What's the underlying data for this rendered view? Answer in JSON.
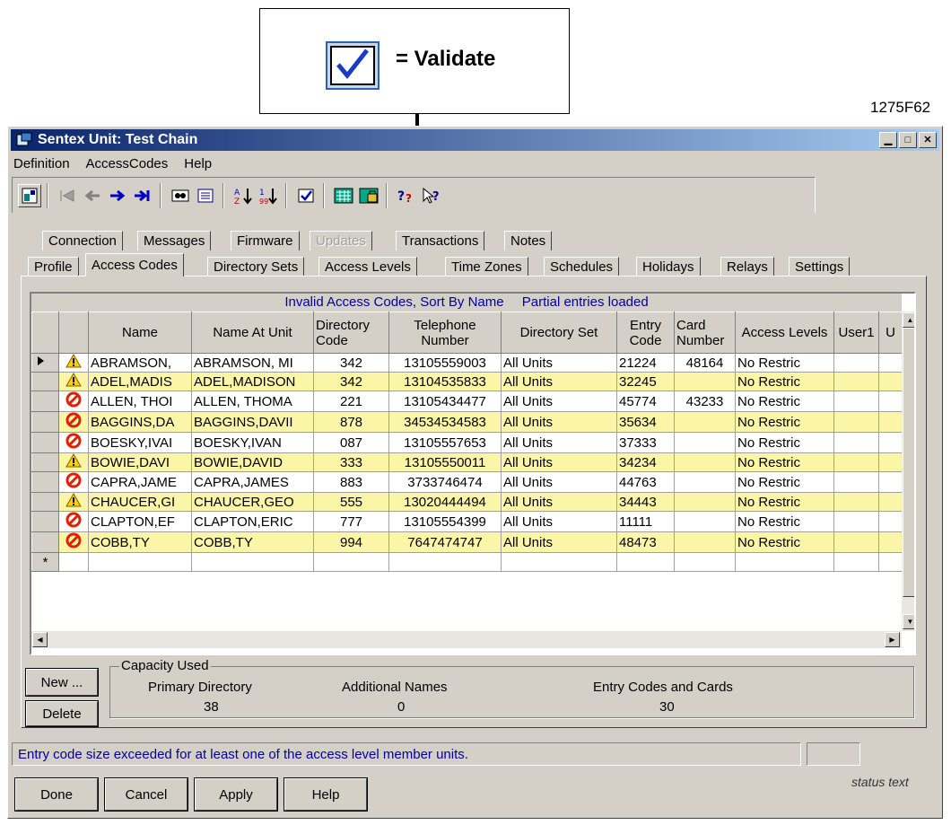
{
  "callout": {
    "label": "= Validate",
    "figure_id": "1275F62"
  },
  "window": {
    "title": "Sentex Unit: Test Chain",
    "controls": [
      "_",
      "□",
      "×"
    ]
  },
  "menu": {
    "definition": "Definition",
    "access_codes": "AccessCodes",
    "help": "Help"
  },
  "tabs_row1": [
    "Connection",
    "Messages",
    "Firmware",
    "Updates",
    "Transactions",
    "Notes"
  ],
  "tabs_row2": [
    "Profile",
    "Access Codes",
    "Directory Sets",
    "Access Levels",
    "Time Zones",
    "Schedules",
    "Holidays",
    "Relays",
    "Settings"
  ],
  "grid": {
    "caption_left": "Invalid Access Codes, Sort By Name",
    "caption_right": "Partial entries loaded",
    "headers": {
      "name": "Name",
      "name_at_unit": "Name At Unit",
      "directory_code": "Directory Code",
      "telephone": "Telephone Number",
      "directory_set": "Directory Set",
      "entry_code": "Entry Code",
      "card_number": "Card Number",
      "access_levels": "Access Levels",
      "user1": "User1",
      "user2": "U"
    },
    "rows": [
      {
        "status": "warning",
        "name": "ABRAMSON,",
        "name_at_unit": "ABRAMSON, MI",
        "directory_code": "342",
        "telephone": "13105559003",
        "directory_set": "All Units",
        "entry_code": "21224",
        "card_number": "48164",
        "access_levels": "No Restric",
        "current": true
      },
      {
        "status": "warning",
        "name": "ADEL,MADIS",
        "name_at_unit": "ADEL,MADISON",
        "directory_code": "342",
        "telephone": "13104535833",
        "directory_set": "All Units",
        "entry_code": "32245",
        "card_number": "",
        "access_levels": "No Restric"
      },
      {
        "status": "error",
        "name": "ALLEN, THOI",
        "name_at_unit": "ALLEN, THOMA",
        "directory_code": "221",
        "telephone": "13105434477",
        "directory_set": "All Units",
        "entry_code": "45774",
        "card_number": "43233",
        "access_levels": "No Restric"
      },
      {
        "status": "error",
        "name": "BAGGINS,DA",
        "name_at_unit": "BAGGINS,DAVII",
        "directory_code": "878",
        "telephone": "34534534583",
        "directory_set": "All Units",
        "entry_code": "35634",
        "card_number": "",
        "access_levels": "No Restric"
      },
      {
        "status": "error",
        "name": "BOESKY,IVAI",
        "name_at_unit": "BOESKY,IVAN",
        "directory_code": "087",
        "telephone": "13105557653",
        "directory_set": "All Units",
        "entry_code": "37333",
        "card_number": "",
        "access_levels": "No Restric"
      },
      {
        "status": "warning",
        "name": "BOWIE,DAVI",
        "name_at_unit": "BOWIE,DAVID",
        "directory_code": "333",
        "telephone": "13105550011",
        "directory_set": "All Units",
        "entry_code": "34234",
        "card_number": "",
        "access_levels": "No Restric"
      },
      {
        "status": "error",
        "name": "CAPRA,JAME",
        "name_at_unit": "CAPRA,JAMES",
        "directory_code": "883",
        "telephone": "3733746474",
        "directory_set": "All Units",
        "entry_code": "44763",
        "card_number": "",
        "access_levels": "No Restric"
      },
      {
        "status": "warning",
        "name": "CHAUCER,GI",
        "name_at_unit": "CHAUCER,GEO",
        "directory_code": "555",
        "telephone": "13020444494",
        "directory_set": "All Units",
        "entry_code": "34443",
        "card_number": "",
        "access_levels": "No Restric"
      },
      {
        "status": "error",
        "name": "CLAPTON,EF",
        "name_at_unit": "CLAPTON,ERIC",
        "directory_code": "777",
        "telephone": "13105554399",
        "directory_set": "All Units",
        "entry_code": "11111",
        "card_number": "",
        "access_levels": "No Restric"
      },
      {
        "status": "error",
        "name": "COBB,TY",
        "name_at_unit": "COBB,TY",
        "directory_code": "994",
        "telephone": "7647474747",
        "directory_set": "All Units",
        "entry_code": "48473",
        "card_number": "",
        "access_levels": "No Restric"
      }
    ],
    "new_row_marker": "*"
  },
  "buttons": {
    "new": "New ...",
    "delete": "Delete",
    "done": "Done",
    "cancel": "Cancel",
    "apply": "Apply",
    "help": "Help"
  },
  "capacity": {
    "legend": "Capacity Used",
    "primary_label": "Primary Directory",
    "primary_value": "38",
    "additional_label": "Additional Names",
    "additional_value": "0",
    "entry_label": "Entry Codes and Cards",
    "entry_value": "30"
  },
  "status": {
    "message": "Entry code size exceeded for at least one of the access level member units.",
    "status_text": "status text"
  },
  "colors": {
    "title_start": "#0a246a",
    "title_end": "#a6caf0",
    "row_highlight": "#fbf5a8",
    "face": "#d4d0c8",
    "caption_text": "#0000a0"
  }
}
